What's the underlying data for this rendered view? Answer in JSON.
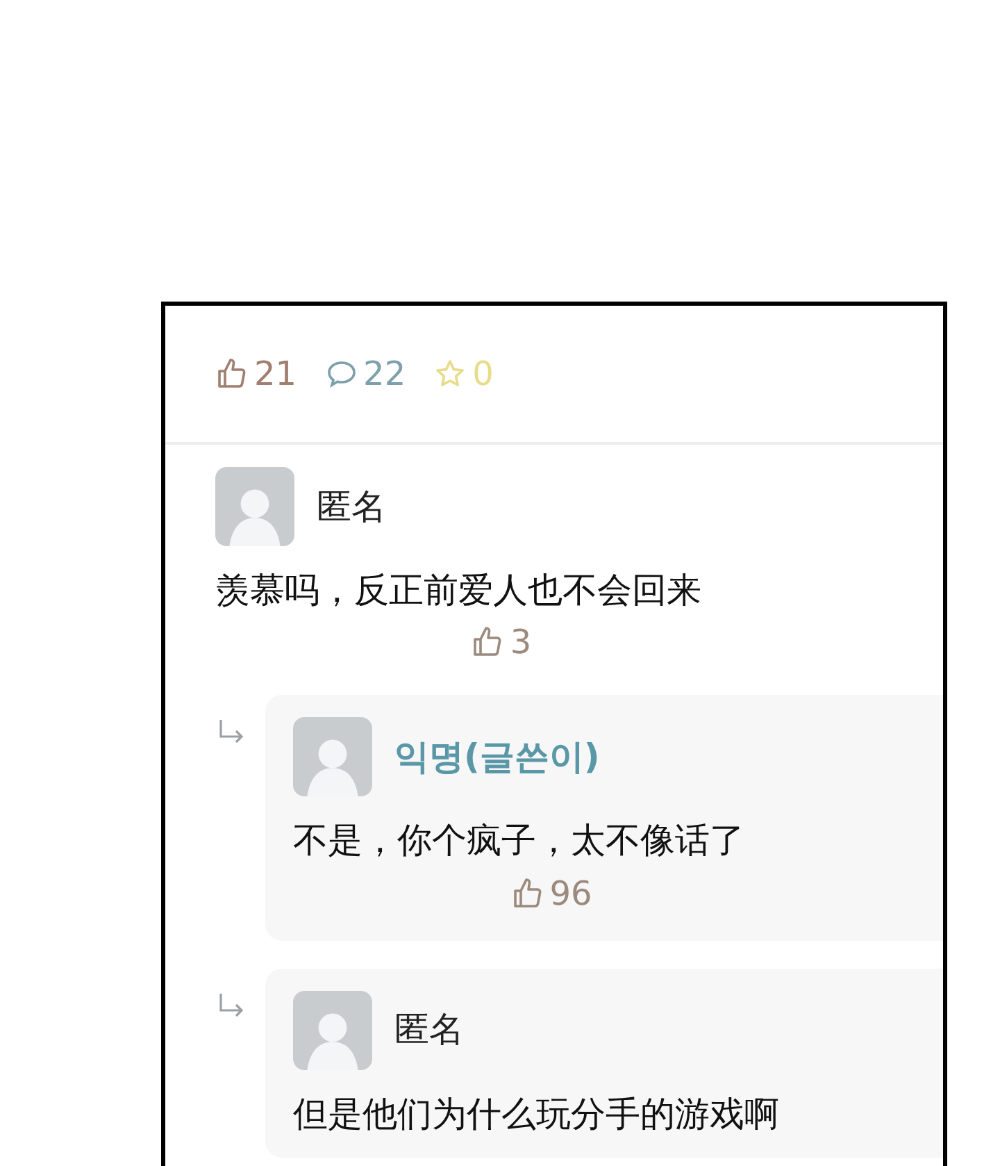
{
  "stats": {
    "likes": "21",
    "comments": "22",
    "favorites": "0"
  },
  "comments": [
    {
      "kind": "comment",
      "name": "匿名",
      "author": false,
      "text": "羡慕吗，反正前爱人也不会回来",
      "likes": "3"
    },
    {
      "kind": "reply",
      "name": "익명(글쓴이)",
      "author": true,
      "text": "不是，你个疯子，太不像话了",
      "likes": "96"
    },
    {
      "kind": "reply",
      "name": "匿名",
      "author": false,
      "text": "但是他们为什么玩分手的游戏啊"
    }
  ]
}
